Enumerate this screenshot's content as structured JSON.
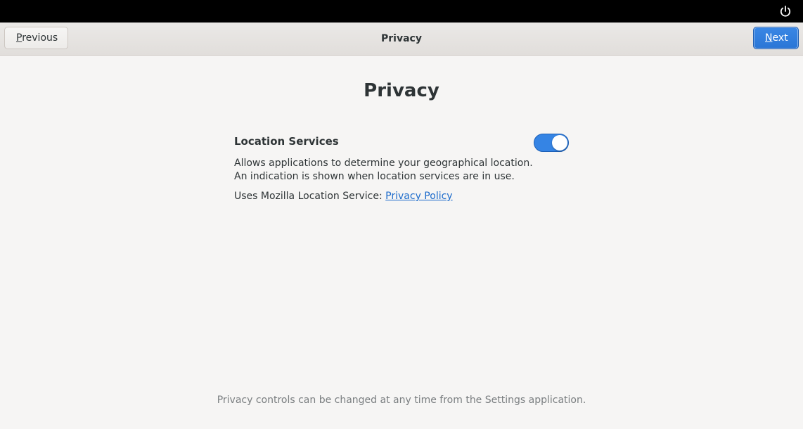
{
  "topbar": {
    "power_icon": "power-icon"
  },
  "header": {
    "title": "Privacy",
    "previous_mnemonic": "P",
    "previous_rest": "revious",
    "next_mnemonic": "N",
    "next_rest": "ext"
  },
  "page": {
    "title": "Privacy"
  },
  "location": {
    "label": "Location Services",
    "enabled": true,
    "description": "Allows applications to determine your geographical location. An indication is shown when location services are in use.",
    "uses_text": "Uses Mozilla Location Service: ",
    "policy_link": "Privacy Policy"
  },
  "footer": {
    "note": "Privacy controls can be changed at any time from the Settings application."
  },
  "colors": {
    "accent": "#3584e4",
    "link": "#1b6acb",
    "background": "#f6f5f4"
  }
}
